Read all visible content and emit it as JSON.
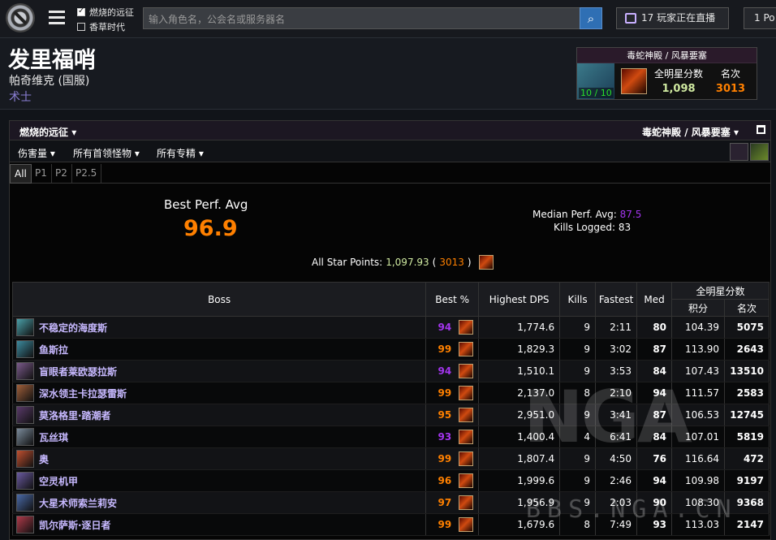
{
  "topbar": {
    "option1": "燃烧的远征",
    "option2": "香草时代",
    "search_placeholder": "输入角色名，公会名或服务器名",
    "twitch_label": "17 玩家正在直播",
    "popular_label": "1 Po"
  },
  "character": {
    "name": "发里福哨",
    "server": "帕奇维克 (国服)",
    "class": "术士"
  },
  "rankbox": {
    "zone": "毒蛇神殿 / 风暴要塞",
    "kills": "10 / 10",
    "points_label": "全明星分数",
    "points_value": "1,098",
    "rank_label": "名次",
    "rank_value": "3013"
  },
  "panel": {
    "expansion": "燃烧的远征",
    "zone": "毒蛇神殿 / 风暴要塞",
    "filters": [
      "伤害量",
      "所有首领怪物",
      "所有专精"
    ],
    "tabs": [
      "All",
      "P1",
      "P2",
      "P2.5"
    ],
    "best_perf_label": "Best Perf. Avg",
    "best_perf_value": "96.9",
    "median_label": "Median Perf. Avg:",
    "median_value": "87.5",
    "kills_label": "Kills Logged:",
    "kills_value": "83",
    "star_label": "All Star Points:",
    "star_value": "1,097.93",
    "star_rank": "3013"
  },
  "table": {
    "headers": {
      "boss": "Boss",
      "best": "Best %",
      "dps": "Highest DPS",
      "kills": "Kills",
      "fastest": "Fastest",
      "med": "Med",
      "allstar": "全明星分数",
      "points": "积分",
      "rank": "名次"
    },
    "rows": [
      {
        "boss": "不稳定的海度斯",
        "best": "94",
        "dps": "1,774.6",
        "kills": "9",
        "fastest": "2:11",
        "med": "80",
        "points": "104.39",
        "rank": "5075"
      },
      {
        "boss": "鱼斯拉",
        "best": "99",
        "dps": "1,829.3",
        "kills": "9",
        "fastest": "3:02",
        "med": "87",
        "points": "113.90",
        "rank": "2643"
      },
      {
        "boss": "盲眼者莱欧瑟拉斯",
        "best": "94",
        "dps": "1,510.1",
        "kills": "9",
        "fastest": "3:53",
        "med": "84",
        "points": "107.43",
        "rank": "13510"
      },
      {
        "boss": "深水领主卡拉瑟雷斯",
        "best": "99",
        "dps": "2,137.0",
        "kills": "8",
        "fastest": "2:10",
        "med": "94",
        "points": "111.57",
        "rank": "2583"
      },
      {
        "boss": "莫洛格里·踏潮者",
        "best": "95",
        "dps": "2,951.0",
        "kills": "9",
        "fastest": "3:41",
        "med": "87",
        "points": "106.53",
        "rank": "12745"
      },
      {
        "boss": "瓦丝琪",
        "best": "93",
        "dps": "1,400.4",
        "kills": "4",
        "fastest": "6:41",
        "med": "84",
        "points": "107.01",
        "rank": "5819"
      },
      {
        "boss": "奥",
        "best": "99",
        "dps": "1,807.4",
        "kills": "9",
        "fastest": "4:50",
        "med": "76",
        "points": "116.64",
        "rank": "472"
      },
      {
        "boss": "空灵机甲",
        "best": "96",
        "dps": "1,999.6",
        "kills": "9",
        "fastest": "2:46",
        "med": "94",
        "points": "109.98",
        "rank": "9197"
      },
      {
        "boss": "大星术师索兰莉安",
        "best": "97",
        "dps": "1,956.9",
        "kills": "9",
        "fastest": "2:03",
        "med": "90",
        "points": "108.30",
        "rank": "9368"
      },
      {
        "boss": "凯尔萨斯·逐日者",
        "best": "99",
        "dps": "1,679.6",
        "kills": "8",
        "fastest": "7:49",
        "med": "93",
        "points": "113.03",
        "rank": "2147"
      }
    ]
  },
  "watermark": {
    "logo": "NGA",
    "url": "BBS.NGA.CN"
  },
  "colors": {
    "legendary": "#ff8000",
    "epic": "#a335ee",
    "rare": "#3f7fe0",
    "accent": "#8a7fd4"
  }
}
